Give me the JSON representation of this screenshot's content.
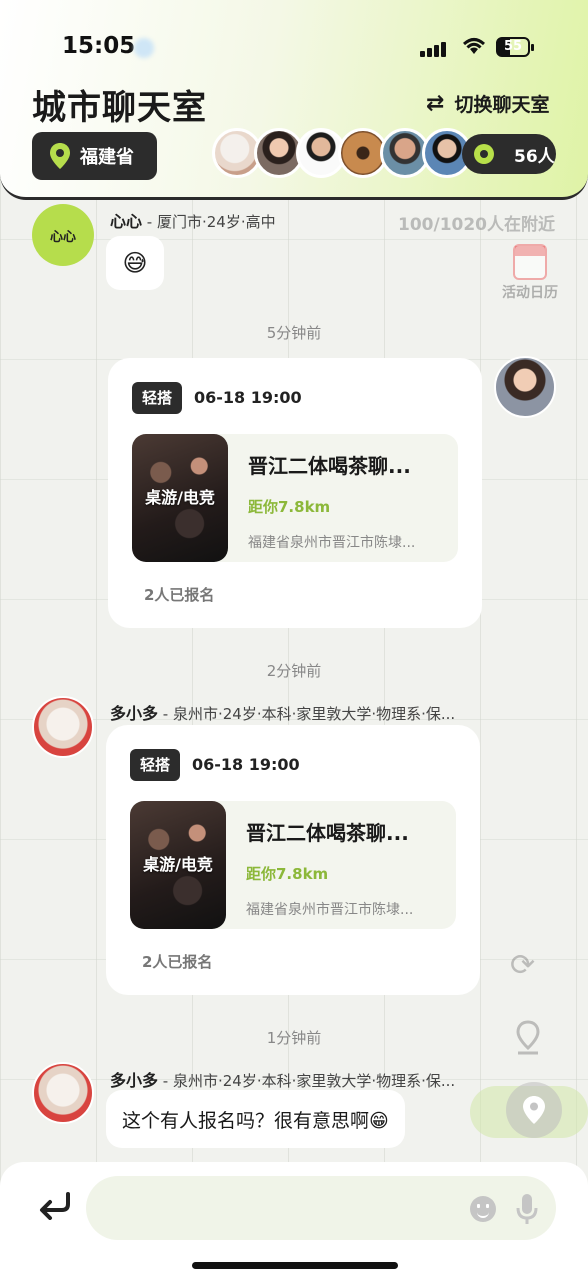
{
  "status_bar": {
    "time": "15:05",
    "battery": "55"
  },
  "header": {
    "title": "城市聊天室",
    "switch_label": "切换聊天室",
    "province": "福建省",
    "online_count": "56人"
  },
  "map_labels": {
    "nearby": "100/1020人在附近",
    "calendar": "活动日历"
  },
  "messages": [
    {
      "sender": "心心",
      "meta": " - 厦门市·24岁·高中",
      "avatar_text": "心心",
      "content": "😅"
    },
    {
      "time": "5分钟前"
    },
    {
      "card": {
        "tag": "轻搭",
        "datetime": "06-18 19:00",
        "image_label": "桌游/电竞",
        "title": "晋江二体喝茶聊...",
        "distance": "距你7.8km",
        "address": "福建省泉州市晋江市陈埭...",
        "signup": "2人已报名"
      }
    },
    {
      "time": "2分钟前"
    },
    {
      "sender": "多小多",
      "meta": " - 泉州市·24岁·本科·家里敦大学·物理系·保...",
      "card": {
        "tag": "轻搭",
        "datetime": "06-18 19:00",
        "image_label": "桌游/电竞",
        "title": "晋江二体喝茶聊...",
        "distance": "距你7.8km",
        "address": "福建省泉州市晋江市陈埭...",
        "signup": "2人已报名"
      }
    },
    {
      "time": "1分钟前"
    },
    {
      "sender": "多小多",
      "meta": " - 泉州市·24岁·本科·家里敦大学·物理系·保...",
      "content": "这个有人报名吗？很有意思啊😁"
    }
  ],
  "colors": {
    "accent": "#b6dd4c",
    "dark": "#2c2c2c",
    "distance": "#8cb83a"
  }
}
